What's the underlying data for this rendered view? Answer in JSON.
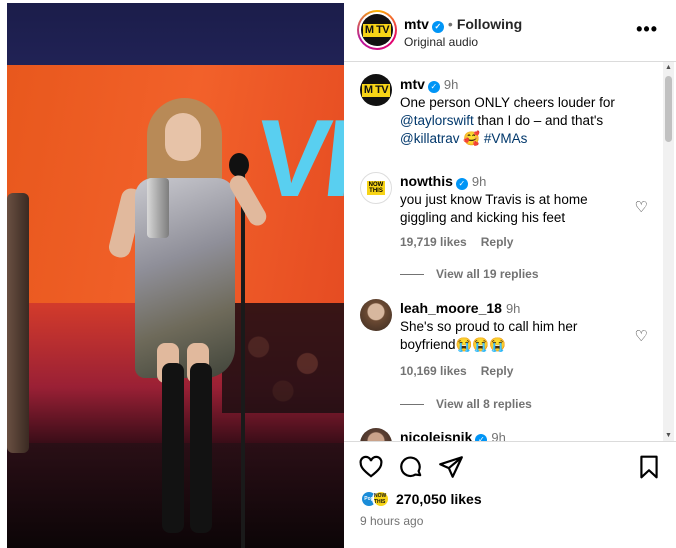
{
  "header": {
    "username": "mtv",
    "follow_status": "Following",
    "audio": "Original audio",
    "more_label": "•••",
    "avatar_mark": "M TV"
  },
  "media": {
    "screen_text": "VII"
  },
  "caption": {
    "username": "mtv",
    "time": "9h",
    "text_1": "One person ONLY cheers louder for",
    "mention_1": "@taylorswift",
    "text_2": " than I do – and that's",
    "mention_2": "@killatrav",
    "emoji": "🥰",
    "hashtag": "#VMAs"
  },
  "comments": [
    {
      "username": "nowthis",
      "verified": true,
      "time": "9h",
      "text": "you just know Travis is at home giggling and kicking his feet",
      "likes": "19,719 likes",
      "reply_label": "Reply",
      "replies_label": "View all 19 replies",
      "avatar_text": "NOW THIS"
    },
    {
      "username": "leah_moore_18",
      "verified": false,
      "time": "9h",
      "text": "She's so proud to call him her boyfriend😭😭😭",
      "likes": "10,169 likes",
      "reply_label": "Reply",
      "replies_label": "View all 8 replies"
    },
    {
      "username": "nicoleisnik",
      "verified": true,
      "time": "9h"
    }
  ],
  "footer": {
    "likes": "270,050 likes",
    "time_ago": "9 hours ago",
    "liker_1": "Pop",
    "liker_2": "NOW THIS"
  },
  "colors": {
    "verified": "#0095f6",
    "link": "#00376b",
    "muted": "#737373",
    "mtv_yellow": "#f7d417"
  }
}
